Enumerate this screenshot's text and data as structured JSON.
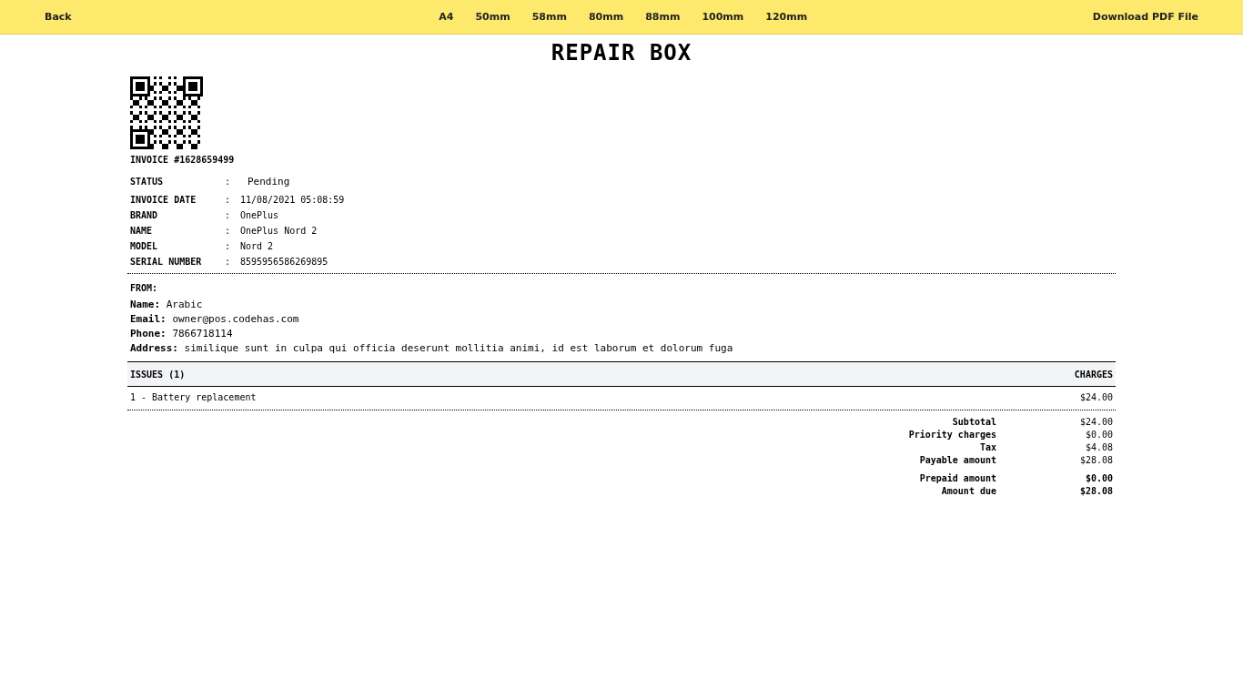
{
  "toolbar": {
    "back": "Back",
    "sizes": [
      "A4",
      "50mm",
      "58mm",
      "80mm",
      "88mm",
      "100mm",
      "120mm"
    ],
    "download": "Download PDF File"
  },
  "title": "REPAIR BOX",
  "invoice_number": "INVOICE #1628659499",
  "status": {
    "label": "STATUS",
    "separator": ":",
    "value": "Pending"
  },
  "details": [
    {
      "label": "INVOICE DATE",
      "separator": ":",
      "value": "11/08/2021 05:08:59"
    },
    {
      "label": "BRAND",
      "separator": ":",
      "value": "OnePlus"
    },
    {
      "label": "NAME",
      "separator": ":",
      "value": "OnePlus Nord 2"
    },
    {
      "label": "MODEL",
      "separator": ":",
      "value": "Nord 2"
    },
    {
      "label": "SERIAL NUMBER",
      "separator": ":",
      "value": "8595956586269895"
    }
  ],
  "from": {
    "heading": "FROM:",
    "lines": [
      {
        "label": "Name:",
        "value": "Arabic"
      },
      {
        "label": "Email:",
        "value": "owner@pos.codehas.com"
      },
      {
        "label": "Phone:",
        "value": "7866718114"
      },
      {
        "label": "Address:",
        "value": "similique sunt in culpa qui officia deserunt mollitia animi, id est laborum et dolorum fuga"
      }
    ]
  },
  "issues": {
    "columns": [
      "ISSUES (1)",
      "CHARGES"
    ],
    "rows": [
      {
        "issue": "1 - Battery replacement",
        "charge": "$24.00"
      }
    ]
  },
  "totals": [
    [
      {
        "label": "Subtotal",
        "value": "$24.00",
        "bold": false
      },
      {
        "label": "Priority charges",
        "value": "$0.00",
        "bold": false
      },
      {
        "label": "Tax",
        "value": "$4.08",
        "bold": false
      },
      {
        "label": "Payable amount",
        "value": "$28.08",
        "bold": false
      }
    ],
    [
      {
        "label": "Prepaid amount",
        "value": "$0.00",
        "bold": true
      },
      {
        "label": "Amount due",
        "value": "$28.08",
        "bold": true
      }
    ]
  ]
}
